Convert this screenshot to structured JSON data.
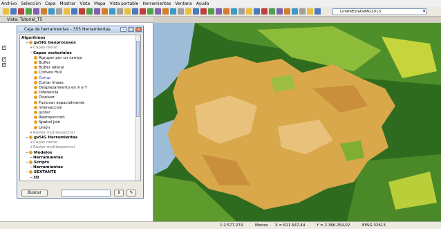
{
  "menu": [
    "Archivo",
    "Selección",
    "Capa",
    "Mostrar",
    "Vista",
    "Mapa",
    "Vista portable",
    "Herramientas",
    "Ventana",
    "Ayuda"
  ],
  "toolbar": {
    "layer_combo_value": "LimiteEstatalMG2013"
  },
  "view_title": "Vista: Tutorial_T5",
  "dialog": {
    "title": "Caja de herramientas - 355 Herramientas",
    "tree": [
      {
        "label": "Algoritmos",
        "bold": true,
        "gray": false,
        "indent": 0,
        "icon": false
      },
      {
        "label": "gvSIG Geoprocesos",
        "bold": true,
        "gray": false,
        "indent": 1,
        "icon": true
      },
      {
        "label": "Capas raster",
        "bold": false,
        "gray": true,
        "indent": 2,
        "icon": false
      },
      {
        "label": "Capas vectoriales",
        "bold": true,
        "gray": false,
        "indent": 2,
        "icon": false
      },
      {
        "label": "Agrupar por un campo",
        "bold": false,
        "gray": false,
        "indent": 3,
        "icon": true
      },
      {
        "label": "Buffer",
        "bold": false,
        "gray": false,
        "indent": 3,
        "icon": true
      },
      {
        "label": "Buffer lateral",
        "bold": false,
        "gray": false,
        "indent": 3,
        "icon": true
      },
      {
        "label": "Convex Hull",
        "bold": false,
        "gray": false,
        "indent": 3,
        "icon": true
      },
      {
        "label": "Cortar",
        "bold": false,
        "gray": false,
        "indent": 3,
        "icon": true,
        "selected": true
      },
      {
        "label": "Cortar líneas",
        "bold": false,
        "gray": false,
        "indent": 3,
        "icon": true
      },
      {
        "label": "Desplazamiento en X e Y",
        "bold": false,
        "gray": false,
        "indent": 3,
        "icon": true
      },
      {
        "label": "Diferencia",
        "bold": false,
        "gray": false,
        "indent": 3,
        "icon": true
      },
      {
        "label": "Disolver",
        "bold": false,
        "gray": false,
        "indent": 3,
        "icon": true
      },
      {
        "label": "Fusionar espacialmente",
        "bold": false,
        "gray": false,
        "indent": 3,
        "icon": true
      },
      {
        "label": "Intersección",
        "bold": false,
        "gray": false,
        "indent": 3,
        "icon": true
      },
      {
        "label": "Juntar",
        "bold": false,
        "gray": false,
        "indent": 3,
        "icon": true
      },
      {
        "label": "Reproyección",
        "bold": false,
        "gray": false,
        "indent": 3,
        "icon": true
      },
      {
        "label": "Spatial Join",
        "bold": false,
        "gray": false,
        "indent": 3,
        "icon": true
      },
      {
        "label": "Unión",
        "bold": false,
        "gray": false,
        "indent": 3,
        "icon": true
      },
      {
        "label": "Raster multiespectral",
        "bold": false,
        "gray": true,
        "indent": 2,
        "icon": false
      },
      {
        "label": "gvSIG Herramientas",
        "bold": true,
        "gray": false,
        "indent": 1,
        "icon": true
      },
      {
        "label": "Capas raster",
        "bold": false,
        "gray": true,
        "indent": 2,
        "icon": false
      },
      {
        "label": "Raster multiespectral",
        "bold": false,
        "gray": true,
        "indent": 2,
        "icon": false
      },
      {
        "label": "Modelos",
        "bold": true,
        "gray": false,
        "indent": 1,
        "icon": true
      },
      {
        "label": "Herramientas",
        "bold": true,
        "gray": false,
        "indent": 2,
        "icon": false
      },
      {
        "label": "Scripts",
        "bold": true,
        "gray": false,
        "indent": 1,
        "icon": true
      },
      {
        "label": "Herramientas",
        "bold": true,
        "gray": false,
        "indent": 2,
        "icon": false
      },
      {
        "label": "SEXTANTE",
        "bold": true,
        "gray": false,
        "indent": 1,
        "icon": true
      },
      {
        "label": "3D",
        "bold": true,
        "gray": false,
        "indent": 2,
        "icon": false
      }
    ],
    "search_button": "Buscar",
    "info_button": "i"
  },
  "status": {
    "scale": "1:2.577.274",
    "units": "Metros",
    "x": "X = 611.547,44",
    "y": "Y = 2.366.254,02",
    "epsg": "EPSG:32613"
  },
  "colors": {
    "accent": "#0a246a",
    "map_orange": "#d9a84a",
    "map_green": "#3d8a2a"
  }
}
